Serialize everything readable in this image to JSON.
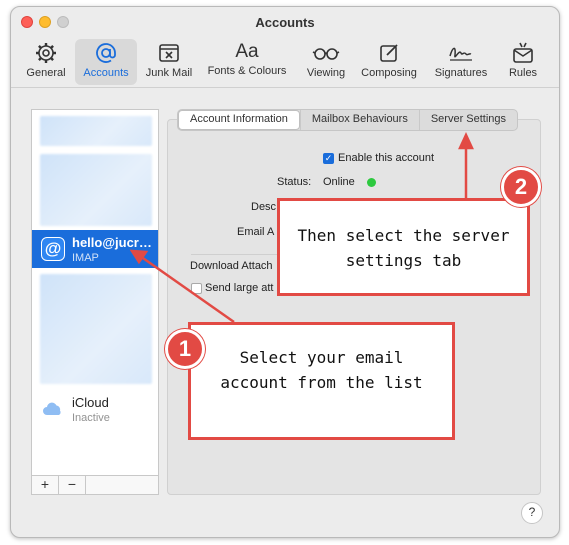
{
  "window": {
    "title": "Accounts"
  },
  "toolbar": {
    "items": [
      {
        "label": "General",
        "icon": "gear-icon"
      },
      {
        "label": "Accounts",
        "icon": "at-sign-icon"
      },
      {
        "label": "Junk Mail",
        "icon": "junk-mail-icon"
      },
      {
        "label": "Fonts & Colours",
        "icon": "fonts-icon",
        "glyph": "Aa"
      },
      {
        "label": "Viewing",
        "icon": "glasses-icon"
      },
      {
        "label": "Composing",
        "icon": "compose-icon"
      },
      {
        "label": "Signatures",
        "icon": "signature-icon"
      },
      {
        "label": "Rules",
        "icon": "rules-icon"
      }
    ],
    "active": "Accounts"
  },
  "accounts": {
    "selected": {
      "name": "hello@jucr…",
      "type": "IMAP"
    },
    "icloud": {
      "name": "iCloud",
      "status": "Inactive"
    },
    "add_label": "+",
    "remove_label": "−"
  },
  "tabs": [
    "Account Information",
    "Mailbox Behaviours",
    "Server Settings"
  ],
  "active_tab": "Account Information",
  "account_info": {
    "enable_label": "Enable this account",
    "status_label": "Status:",
    "status_value": "Online",
    "status_color": "#2dc93f",
    "description_label_partial": "Desc",
    "email_label_partial": "Email A",
    "download_label_partial": "Download Attach",
    "send_large_partial": "Send large att"
  },
  "help_label": "?",
  "annotations": {
    "step1_number": "1",
    "step1_text": "Select your email account from the list",
    "step2_number": "2",
    "step2_text": "Then select the server settings tab",
    "color": "#e24a44"
  }
}
